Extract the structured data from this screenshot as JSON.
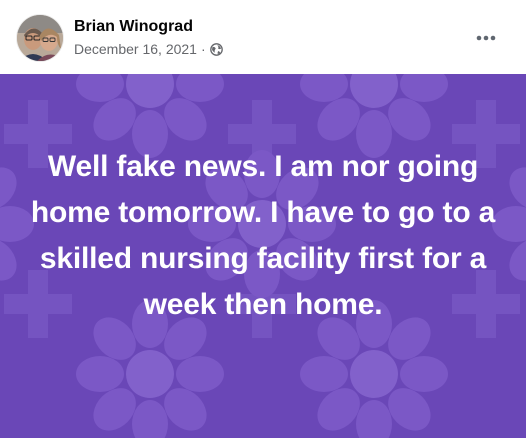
{
  "post": {
    "author": "Brian Winograd",
    "date": "December 16, 2021",
    "separator": "·",
    "privacy_icon": "globe-icon",
    "more_icon": "more-horizontal-icon",
    "text": "Well fake news. I am nor going home tomorrow. I have to go to a skilled nursing facility first for a week then home.",
    "background_color": "#6a47b7",
    "text_color": "#ffffff"
  }
}
